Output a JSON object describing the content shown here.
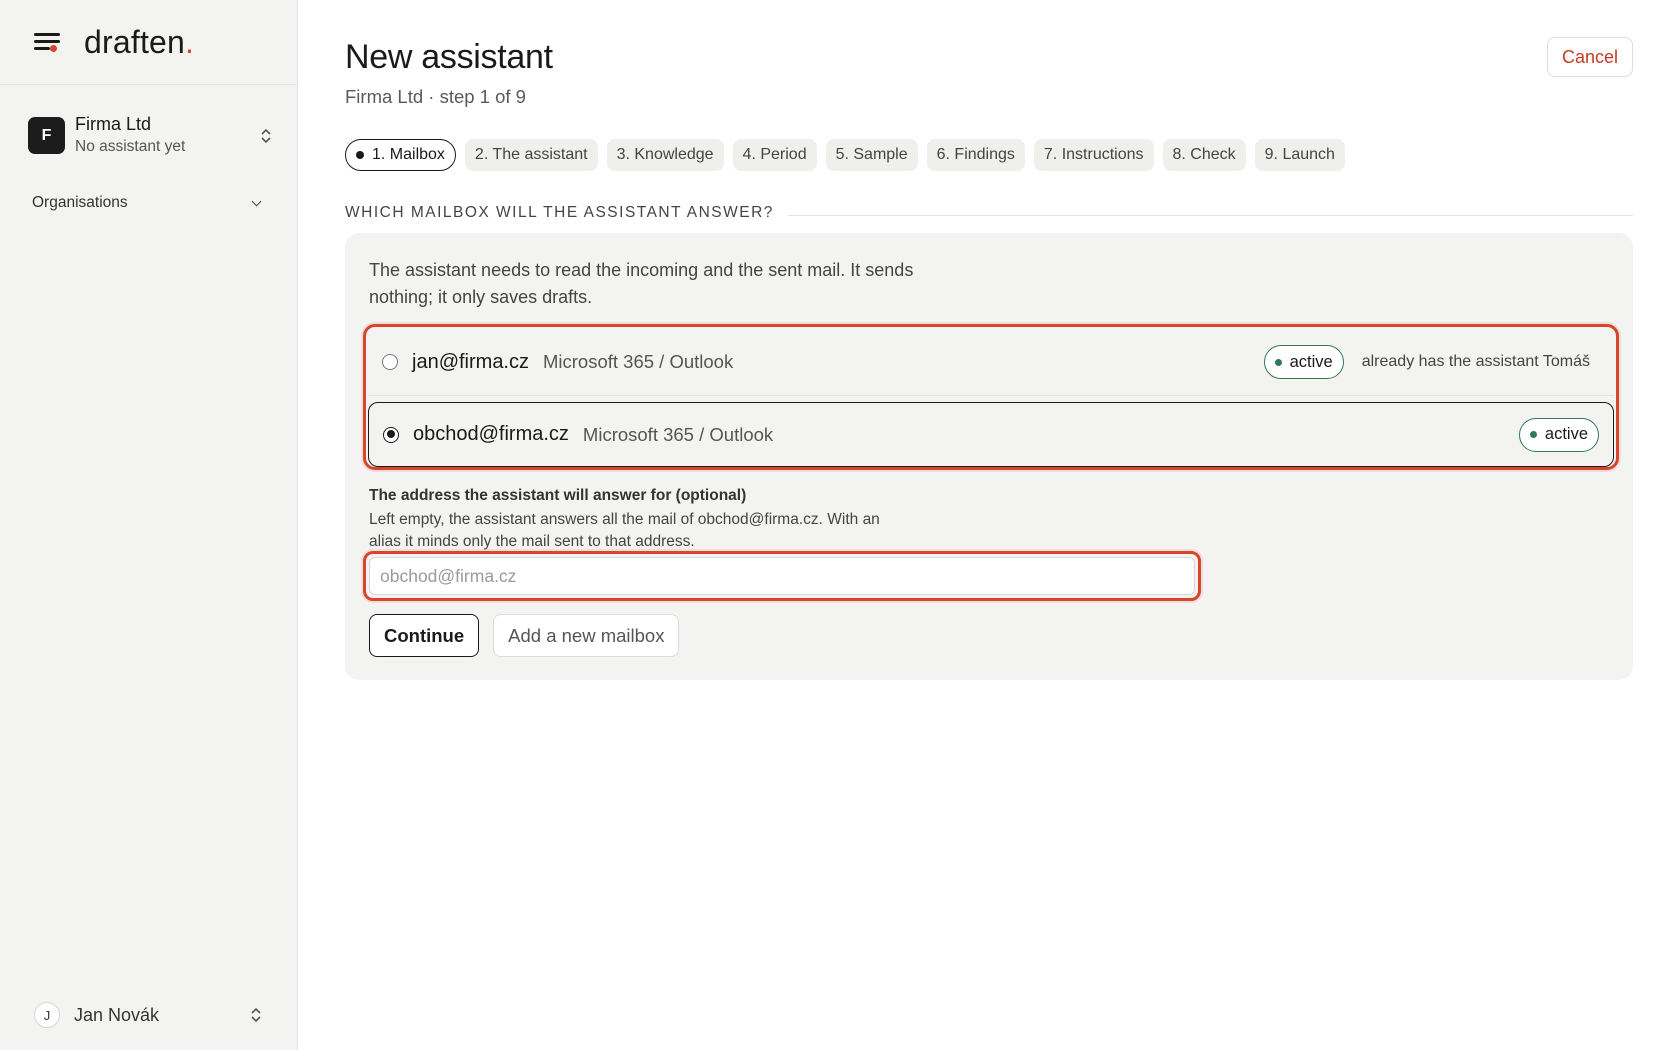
{
  "brand": {
    "name": "draften",
    "dot": "."
  },
  "sidebar": {
    "org": {
      "avatar": "F",
      "name": "Firma Ltd",
      "subtitle": "No assistant yet"
    },
    "nav": {
      "organisations": "Organisations"
    },
    "user": {
      "avatar": "J",
      "name": "Jan Novák"
    }
  },
  "header": {
    "title": "New assistant",
    "subtitle": "Firma Ltd · step 1 of 9",
    "cancel": "Cancel"
  },
  "steps": [
    {
      "label": "1. Mailbox",
      "active": true
    },
    {
      "label": "2. The assistant"
    },
    {
      "label": "3. Knowledge"
    },
    {
      "label": "4. Period"
    },
    {
      "label": "5. Sample"
    },
    {
      "label": "6. Findings"
    },
    {
      "label": "7. Instructions"
    },
    {
      "label": "8. Check"
    },
    {
      "label": "9. Launch"
    }
  ],
  "section": {
    "title": "Which mailbox will the assistant answer?",
    "intro": "The assistant needs to read the incoming and the sent mail. It sends nothing; it only saves drafts."
  },
  "mailboxes": [
    {
      "email": "jan@firma.cz",
      "provider": "Microsoft 365 / Outlook",
      "status": "active",
      "note": "already has the assistant Tomáš",
      "selected": false
    },
    {
      "email": "obchod@firma.cz",
      "provider": "Microsoft 365 / Outlook",
      "status": "active",
      "note": "",
      "selected": true
    }
  ],
  "alias": {
    "label": "The address the assistant will answer for (optional)",
    "help": "Left empty, the assistant answers all the mail of obchod@firma.cz. With an alias it minds only the mail sent to that address.",
    "placeholder": "obchod@firma.cz",
    "value": ""
  },
  "actions": {
    "continue": "Continue",
    "add_mailbox": "Add a new mailbox"
  },
  "colors": {
    "accent": "#d8452a",
    "active_green": "#2e7a54",
    "panel_bg": "#f3f3f1"
  },
  "icons": {
    "menu": "menu-icon",
    "org_switch": "updown-icon",
    "nav_chevron": "chevron-down-icon",
    "user_switch": "updown-icon"
  }
}
